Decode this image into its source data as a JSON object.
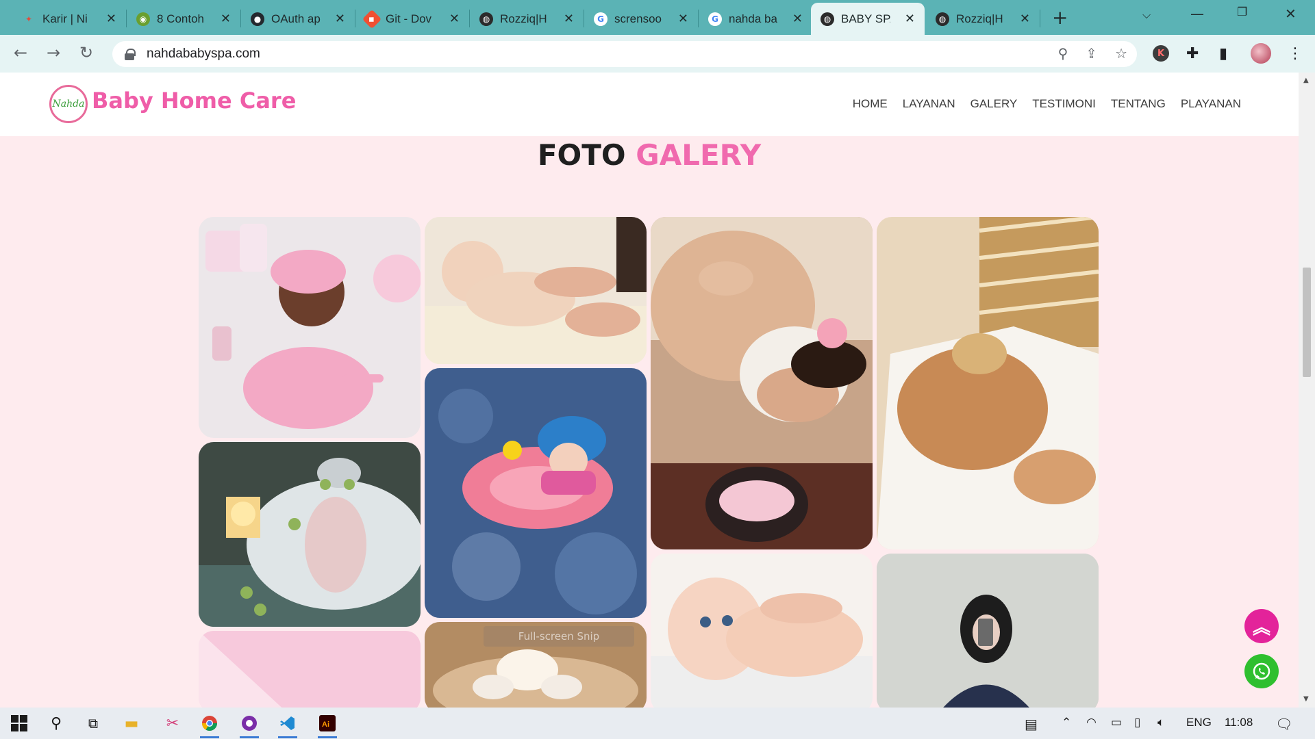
{
  "browser": {
    "tabs": [
      {
        "label": "Karir | Ni",
        "icon": "ninja-icon",
        "color": "#e24b3b",
        "active": false
      },
      {
        "label": "8 Contoh",
        "icon": "owl-icon",
        "color": "#6a9f2f",
        "active": false
      },
      {
        "label": "OAuth ap",
        "icon": "github-icon",
        "color": "#24292e",
        "active": false
      },
      {
        "label": "Git - Dov",
        "icon": "git-icon",
        "color": "#f05032",
        "active": false
      },
      {
        "label": "Rozziq|H",
        "icon": "globe-icon",
        "color": "#2b2b2b",
        "active": false
      },
      {
        "label": "scrensoo",
        "icon": "google-icon",
        "color": "#4285f4",
        "active": false
      },
      {
        "label": "nahda ba",
        "icon": "google-icon",
        "color": "#4285f4",
        "active": false
      },
      {
        "label": "BABY SPA",
        "icon": "globe-icon",
        "color": "#2b2b2b",
        "active": true
      },
      {
        "label": "Rozziq|H",
        "icon": "globe-icon",
        "color": "#2b2b2b",
        "active": false
      }
    ],
    "url": "nahdababyspa.com"
  },
  "site": {
    "logo_text": "Nahda",
    "brand": "Baby Home Care",
    "nav": [
      "HOME",
      "LAYANAN",
      "GALERY",
      "TESTIMONI",
      "TENTANG",
      "PLAYANAN"
    ],
    "gallery_title_a": "FOTO",
    "gallery_title_b": "GALERY",
    "overlay_text": "Full-screen Snip",
    "colors": {
      "brand": "#ef5da8",
      "page_bg": "#feebee",
      "accent": "#f06aae"
    }
  },
  "taskbar": {
    "apps": [
      "windows-start-icon",
      "search-icon",
      "task-view-icon",
      "file-explorer-icon",
      "snip-tool-icon",
      "chrome-icon",
      "github-desktop-icon",
      "vscode-icon",
      "illustrator-icon"
    ],
    "language": "ENG",
    "time": "11:08"
  }
}
